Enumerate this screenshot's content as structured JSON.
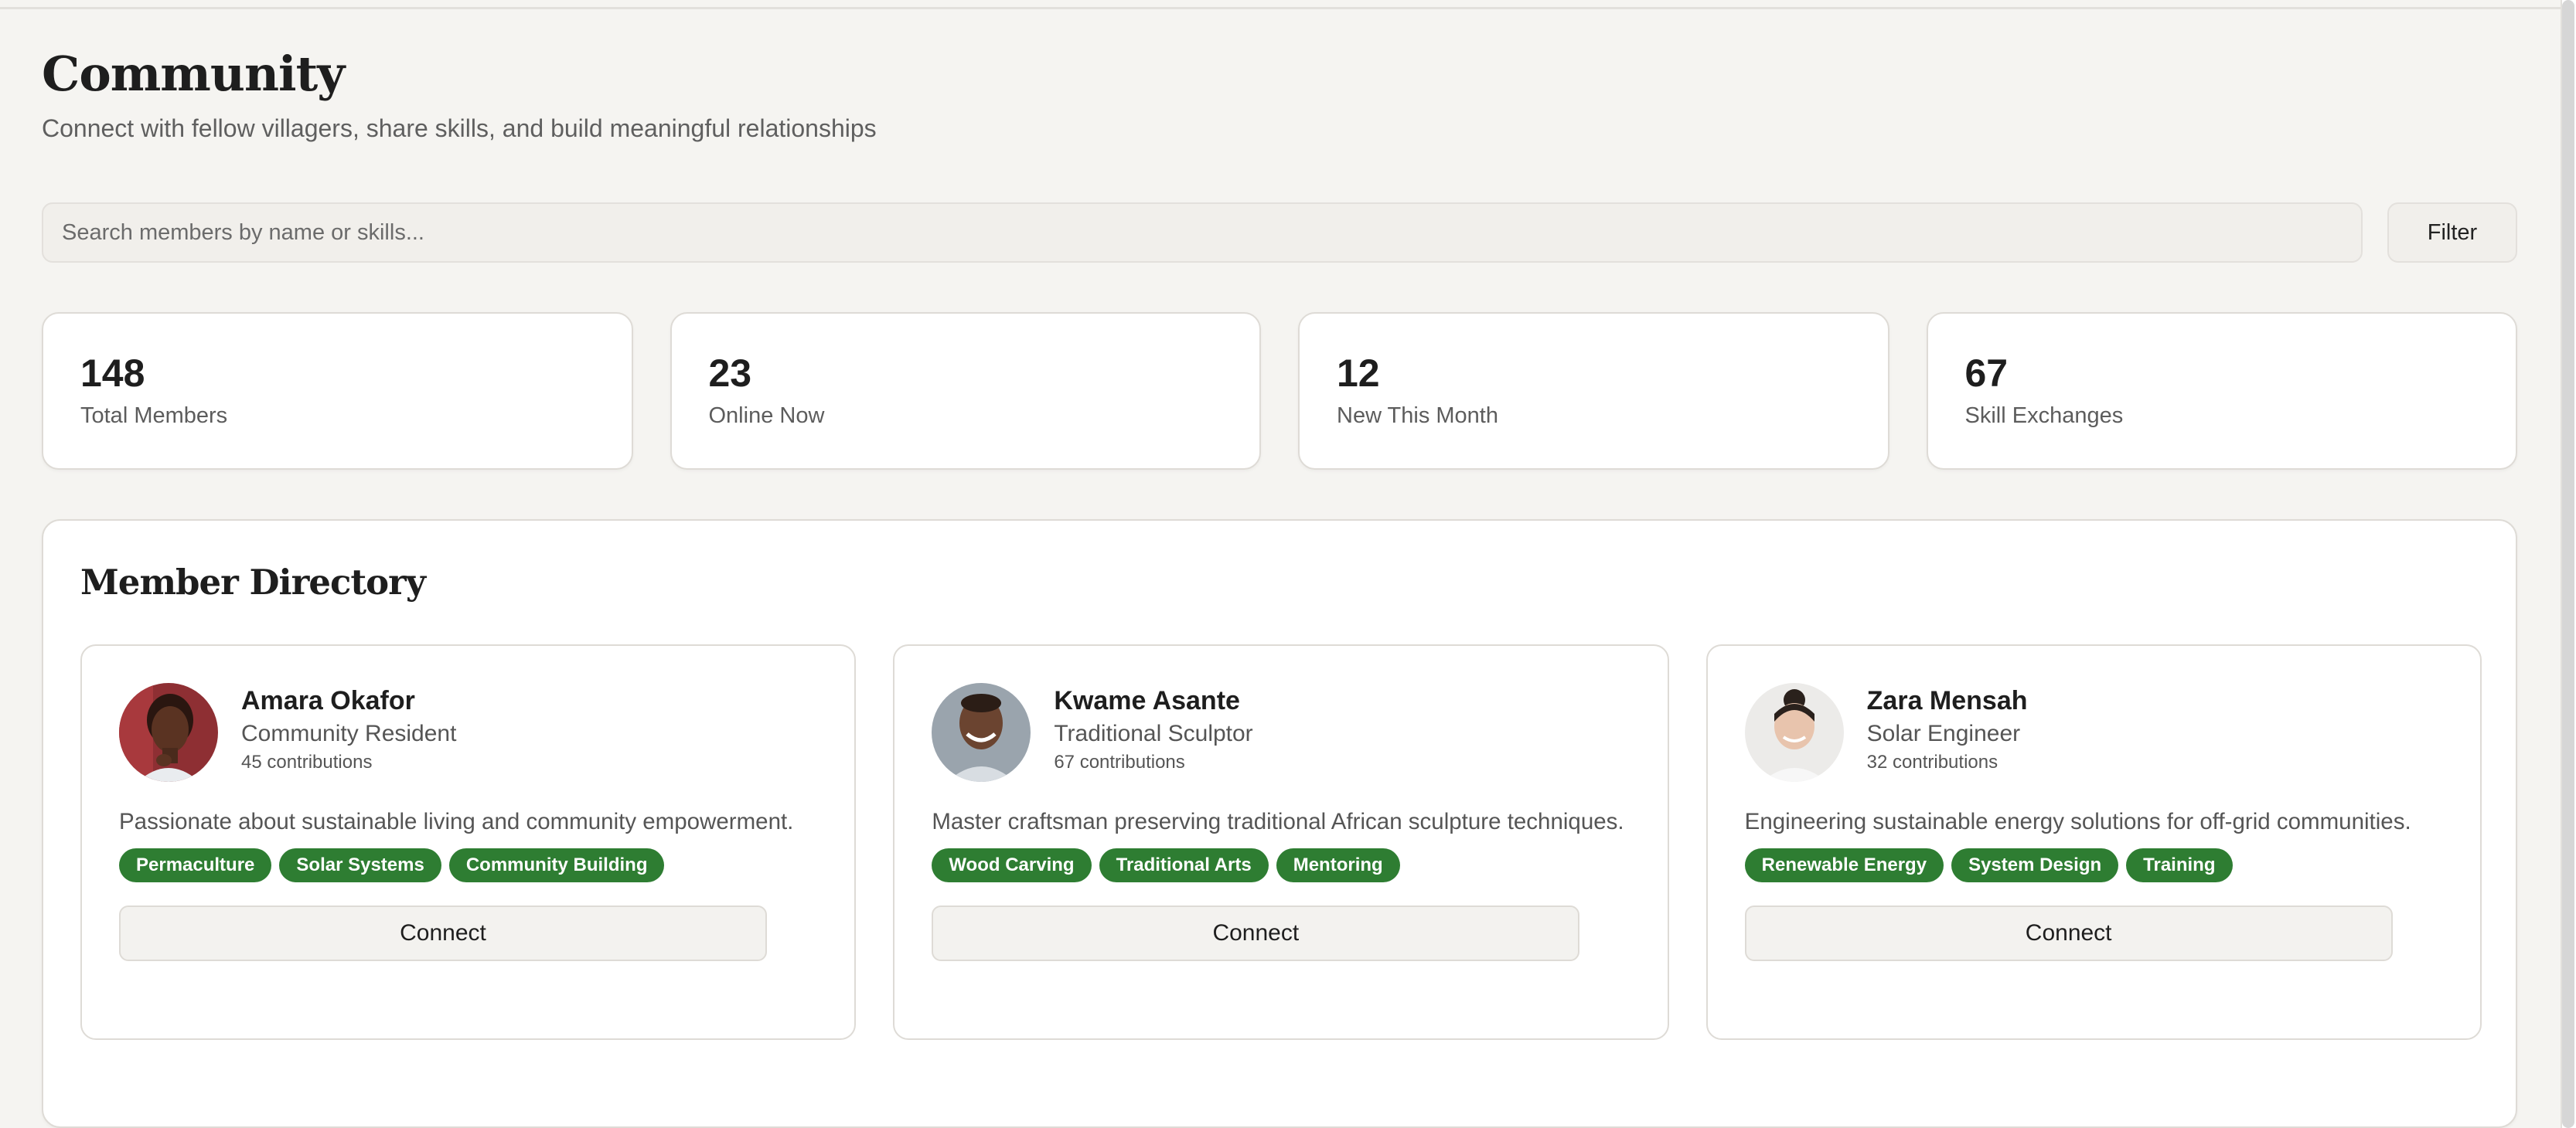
{
  "page": {
    "title": "Community",
    "subtitle": "Connect with fellow villagers, share skills, and build meaningful relationships"
  },
  "search": {
    "placeholder": "Search members by name or skills...",
    "filter_label": "Filter"
  },
  "stats": [
    {
      "value": "148",
      "label": "Total Members"
    },
    {
      "value": "23",
      "label": "Online Now"
    },
    {
      "value": "12",
      "label": "New This Month"
    },
    {
      "value": "67",
      "label": "Skill Exchanges"
    }
  ],
  "directory": {
    "title": "Member Directory",
    "members": [
      {
        "name": "Amara Okafor",
        "role": "Community Resident",
        "contributions": "45 contributions",
        "bio": "Passionate about sustainable living and community empowerment.",
        "tags": [
          "Permaculture",
          "Solar Systems",
          "Community Building"
        ],
        "connect_label": "Connect"
      },
      {
        "name": "Kwame Asante",
        "role": "Traditional Sculptor",
        "contributions": "67 contributions",
        "bio": "Master craftsman preserving traditional African sculpture techniques.",
        "tags": [
          "Wood Carving",
          "Traditional Arts",
          "Mentoring"
        ],
        "connect_label": "Connect"
      },
      {
        "name": "Zara Mensah",
        "role": "Solar Engineer",
        "contributions": "32 contributions",
        "bio": "Engineering sustainable energy solutions for off-grid communities.",
        "tags": [
          "Renewable Energy",
          "System Design",
          "Training"
        ],
        "connect_label": "Connect"
      }
    ]
  },
  "colors": {
    "background": "#f5f4f1",
    "card": "#ffffff",
    "tag": "#2e7d32",
    "border": "#dedbd6"
  }
}
